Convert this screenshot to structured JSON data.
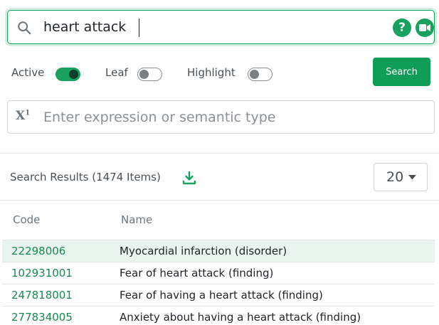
{
  "search": {
    "value": "heart attack",
    "help_label": "?"
  },
  "filters": {
    "active": {
      "label": "Active",
      "on": true
    },
    "leaf": {
      "label": "Leaf",
      "on": false
    },
    "highlight": {
      "label": "Highlight",
      "on": false
    }
  },
  "search_button_label": "Search",
  "expression": {
    "icon_text": "X",
    "icon_sup": "1",
    "placeholder": "Enter expression or semantic type"
  },
  "results": {
    "title": "Search Results (1474 Items)",
    "page_size": "20",
    "columns": {
      "code": "Code",
      "name": "Name"
    },
    "rows": [
      {
        "code": "22298006",
        "name": "Myocardial infarction (disorder)",
        "highlighted": true
      },
      {
        "code": "102931001",
        "name": "Fear of heart attack (finding)",
        "highlighted": false
      },
      {
        "code": "247818001",
        "name": "Fear of having a heart attack (finding)",
        "highlighted": false
      },
      {
        "code": "277834005",
        "name": "Anxiety about having a heart attack (finding)",
        "highlighted": false
      }
    ]
  },
  "colors": {
    "accent": "#19a15f",
    "button": "#0f9d58",
    "code_link": "#19894f",
    "row_highlight": "#e9f4ee"
  }
}
